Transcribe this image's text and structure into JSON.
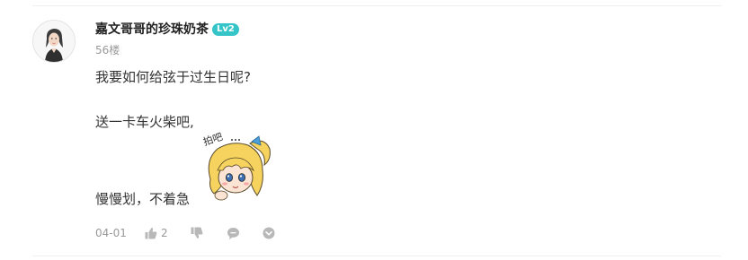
{
  "comment": {
    "username": "嘉文哥哥的珍珠奶茶",
    "level": "Lv2",
    "floor": "56楼",
    "content": {
      "line1": "我要如何给弦于过生日呢?",
      "line2": "送一卡车火柴吧,",
      "line3": "慢慢划，不着急"
    },
    "sticker_text": "拍吧",
    "date": "04-01",
    "like_count": "2"
  },
  "colors": {
    "level_badge": "#35c4c8",
    "muted_text": "#999999",
    "body_text": "#333333",
    "icon": "#b8b8b8"
  },
  "icons": [
    "like-icon",
    "dislike-icon",
    "reply-icon",
    "more-icon"
  ]
}
